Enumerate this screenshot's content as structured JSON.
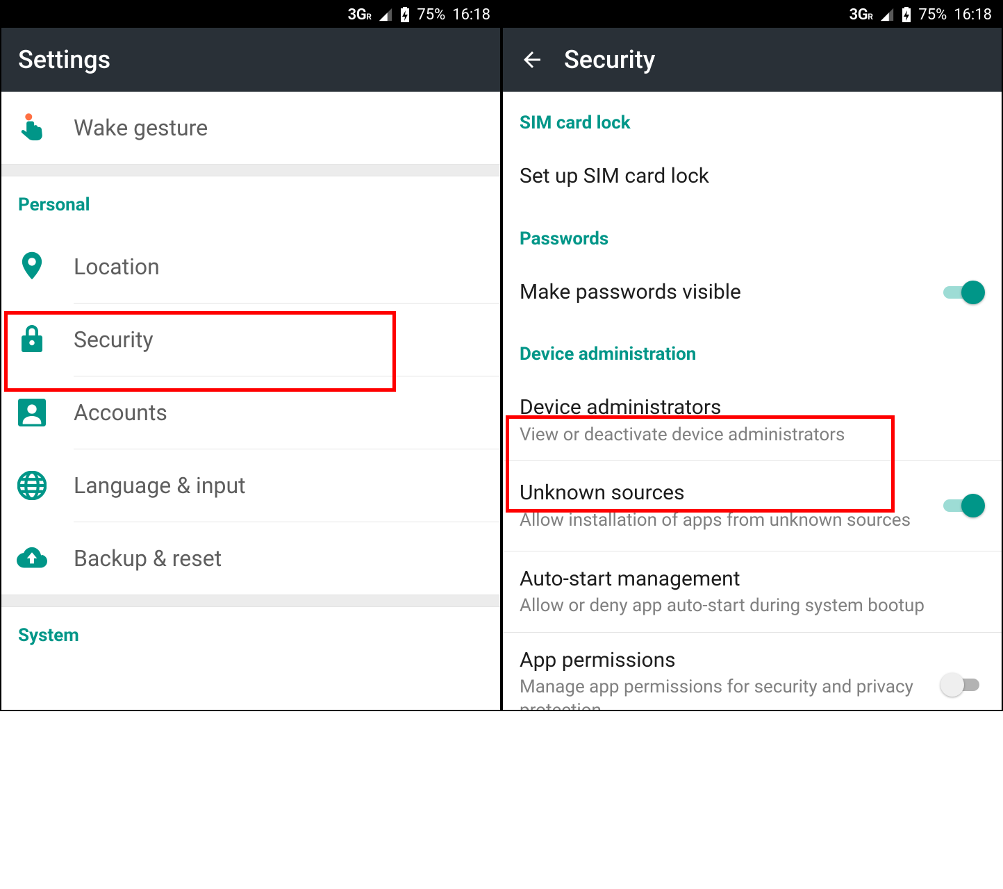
{
  "status": {
    "network": "3G",
    "network_sup": "R",
    "battery": "75%",
    "time": "16:18"
  },
  "left": {
    "title": "Settings",
    "items": {
      "wake": "Wake gesture",
      "location": "Location",
      "security": "Security",
      "accounts": "Accounts",
      "language": "Language & input",
      "backup": "Backup & reset"
    },
    "sections": {
      "personal": "Personal",
      "system": "System"
    }
  },
  "right": {
    "title": "Security",
    "sections": {
      "sim": "SIM card lock",
      "passwords": "Passwords",
      "devadmin": "Device administration"
    },
    "items": {
      "sim_setup": "Set up SIM card lock",
      "pwd_visible": "Make passwords visible",
      "dev_admins": {
        "t": "Device administrators",
        "s": "View or deactivate device administrators"
      },
      "unknown": {
        "t": "Unknown sources",
        "s": "Allow installation of apps from unknown sources"
      },
      "autostart": {
        "t": "Auto-start management",
        "s": "Allow or deny app auto-start during system bootup"
      },
      "perms": {
        "t": "App permissions",
        "s": "Manage app permissions for security and privacy protection"
      }
    }
  }
}
